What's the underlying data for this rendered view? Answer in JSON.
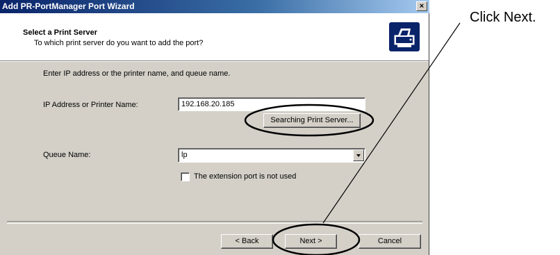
{
  "window": {
    "title": "Add PR-PortManager Port Wizard",
    "close_label": "×"
  },
  "header": {
    "title": "Select a Print Server",
    "subtitle": "To which print server do you want to add the port?",
    "icon": "printer-icon"
  },
  "body": {
    "instruction": "Enter IP address or the printer name, and queue name.",
    "ip_label": "IP Address or Printer Name:",
    "ip_value": "192.168.20.185",
    "search_button": "Searching Print Server...",
    "queue_label": "Queue Name:",
    "queue_value": "lp",
    "checkbox_label": "The extension port is not used",
    "checkbox_checked": false
  },
  "footer": {
    "back_label": "< Back",
    "next_label": "Next >",
    "cancel_label": "Cancel"
  },
  "annotation": {
    "text": "Click Next.",
    "color": "#000000"
  }
}
